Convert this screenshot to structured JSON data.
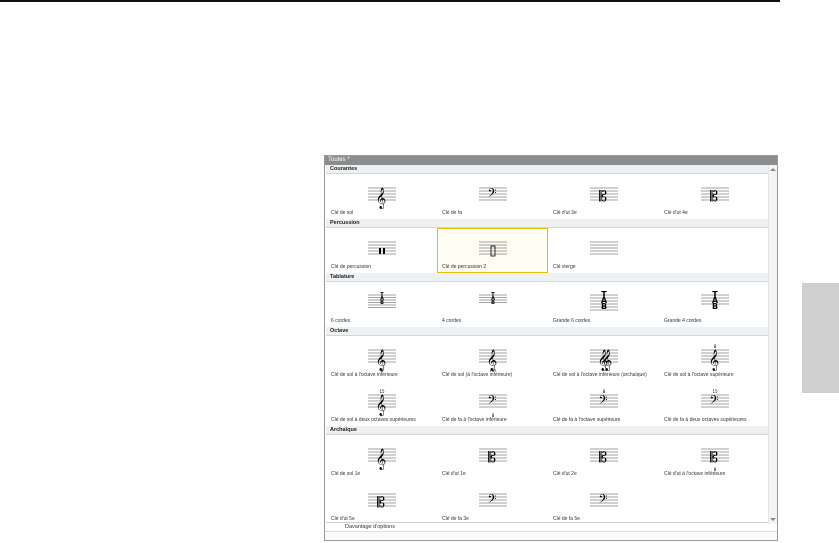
{
  "panel": {
    "title": "Toutes *",
    "more_options": "Davantage d'options"
  },
  "sections": [
    {
      "title": "Courantes",
      "items": [
        {
          "label": "Clé de sol",
          "symbol": "treble"
        },
        {
          "label": "Clé de fa",
          "symbol": "bass"
        },
        {
          "label": "Clé d'ut 3e",
          "symbol": "alto"
        },
        {
          "label": "Clé d'ut 4e",
          "symbol": "tenor"
        }
      ]
    },
    {
      "title": "Percussion",
      "items": [
        {
          "label": "Clé de percussion",
          "symbol": "perc"
        },
        {
          "label": "Clé de percussion 2",
          "symbol": "perc2",
          "selected": true
        },
        {
          "label": "Clé vierge",
          "symbol": "blank"
        }
      ]
    },
    {
      "title": "Tablature",
      "items": [
        {
          "label": "6 cordes",
          "symbol": "tab6",
          "tab": [
            "T",
            "A",
            "B"
          ]
        },
        {
          "label": "4 cordes",
          "symbol": "tab4",
          "tab": [
            "T",
            "A",
            "B"
          ]
        },
        {
          "label": "Grande 6 cordes",
          "symbol": "tab6big",
          "tab": [
            "T",
            "A",
            "B"
          ]
        },
        {
          "label": "Grande 4 cordes",
          "symbol": "tab4big",
          "tab": [
            "T",
            "A",
            "B"
          ]
        }
      ]
    },
    {
      "title": "Octave",
      "items": [
        {
          "label": "Clé de sol à l'octave inférieure",
          "symbol": "treble8vb",
          "mark": "8"
        },
        {
          "label": "Clé de sol (à l'octave inférieure)",
          "symbol": "treble8paren",
          "mark": "(8)"
        },
        {
          "label": "Clé de sol à l'octave inférieure (archaïque)",
          "symbol": "trebleArch"
        },
        {
          "label": "Clé de sol à l'octave supérieure",
          "symbol": "treble8va",
          "mark": "8"
        },
        {
          "label": "Clé de sol à deux octaves supérieures",
          "symbol": "treble15ma",
          "mark": "15"
        },
        {
          "label": "Clé de fa à l'octave inférieure",
          "symbol": "bass8vb",
          "mark": "8"
        },
        {
          "label": "Clé de fa à l'octave supérieure",
          "symbol": "bass8va",
          "mark": "8"
        },
        {
          "label": "Clé de fa à deux octaves supérieures",
          "symbol": "bass15ma",
          "mark": "15"
        }
      ]
    },
    {
      "title": "Archaïque",
      "items": [
        {
          "label": "Clé de sol 1e",
          "symbol": "trebleFrench"
        },
        {
          "label": "Clé d'ut 1e",
          "symbol": "soprano"
        },
        {
          "label": "Clé d'ut 2e",
          "symbol": "mezzo"
        },
        {
          "label": "Clé d'ut à l'octave inférieure",
          "symbol": "tenor8vb",
          "mark": "8"
        },
        {
          "label": "Clé d'ut 5e",
          "symbol": "baritoneC"
        },
        {
          "label": "Clé de fa 3e",
          "symbol": "baritoneF"
        },
        {
          "label": "Clé de fa 5e",
          "symbol": "subbass"
        }
      ]
    }
  ]
}
